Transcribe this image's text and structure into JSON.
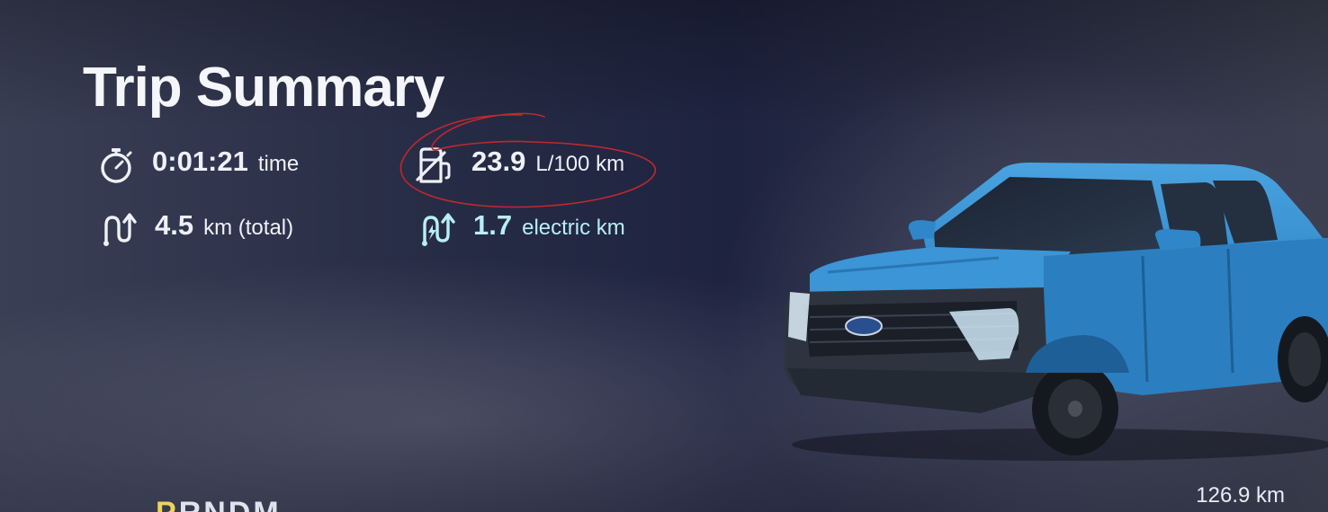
{
  "header": {
    "title": "Trip Summary"
  },
  "stats": {
    "time": {
      "value": "0:01:21",
      "unit": "time",
      "icon": "stopwatch-icon"
    },
    "distance": {
      "value": "4.5",
      "unit": "km (total)",
      "icon": "route-icon"
    },
    "fuel_economy": {
      "value": "23.9",
      "unit": "L/100 km",
      "icon": "fuel-pump-icon"
    },
    "electric_distance": {
      "value": "1.7",
      "unit": "electric km",
      "icon": "electric-route-icon"
    }
  },
  "odometer": {
    "value": "126.9 km"
  },
  "gear_selector": {
    "active": "P",
    "others": "RNDM"
  },
  "colors": {
    "electric_accent": "#b8eef6",
    "gear_active": "#f0d35a",
    "annotation_circle": "#c0282d",
    "vehicle_body": "#2f86c9"
  }
}
